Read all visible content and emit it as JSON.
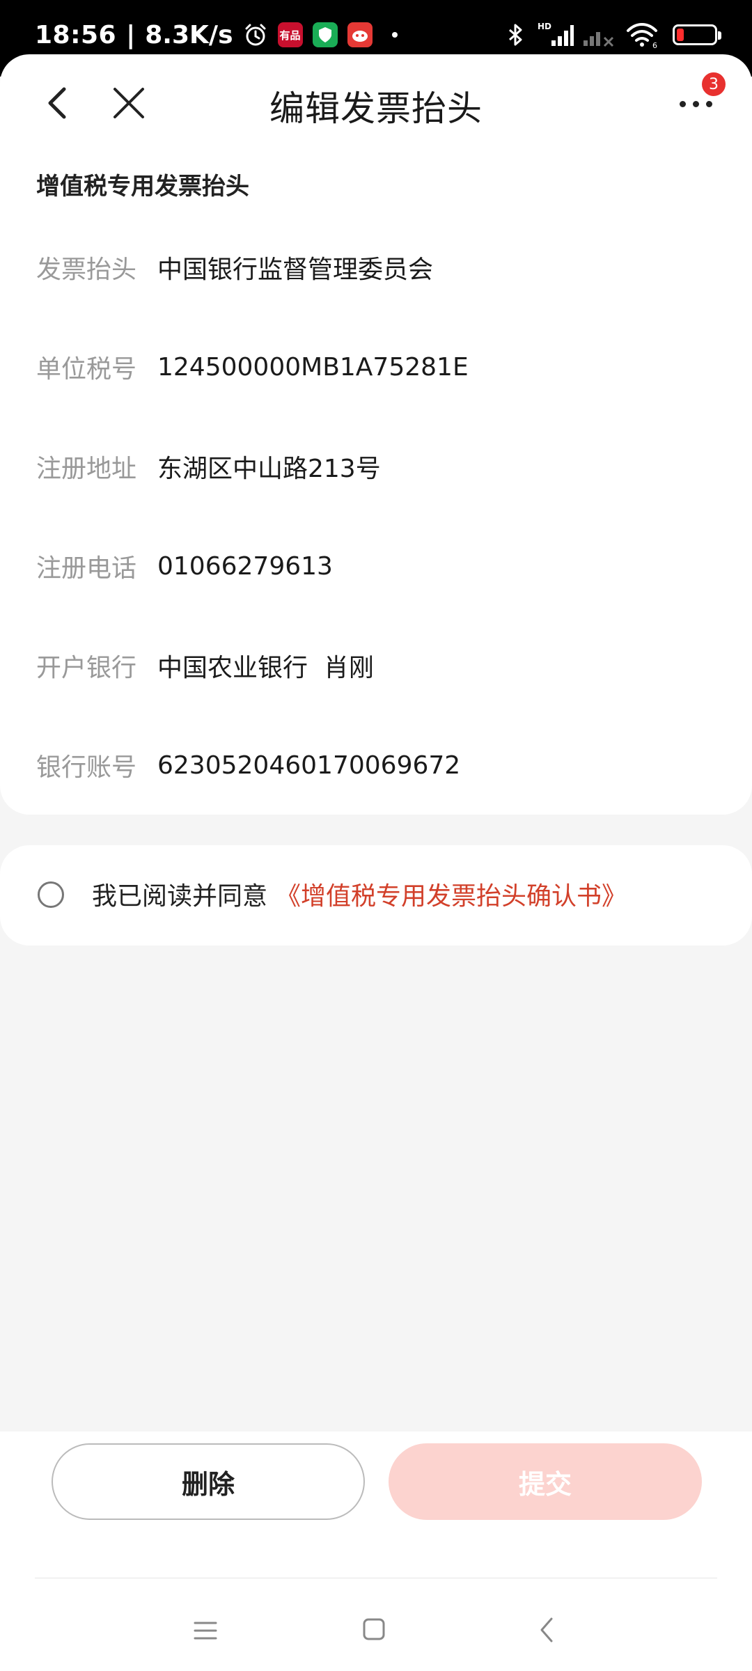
{
  "status_bar": {
    "time": "18:56",
    "separator": "|",
    "net_speed": "8.3K/s",
    "app_icons": [
      {
        "name": "alarm-icon"
      },
      {
        "name": "app-red-icon",
        "label": "有品"
      },
      {
        "name": "shield-app-icon"
      },
      {
        "name": "red-app-icon"
      }
    ],
    "right_icons": [
      "bluetooth-icon",
      "hd-signal-icon",
      "signal-off-icon",
      "wifi-icon",
      "battery-icon"
    ],
    "hd_label": "HD",
    "wifi_label": "6",
    "battery_color": "#ff2d2d"
  },
  "header": {
    "title": "编辑发票抬头",
    "back_icon": "chevron-left-icon",
    "close_icon": "close-icon",
    "more_icon": "more-dots-icon",
    "badge_count": "3"
  },
  "invoice": {
    "section_title": "增值税专用发票抬头",
    "fields": [
      {
        "label": "发票抬头",
        "value": "中国银行监督管理委员会"
      },
      {
        "label": "单位税号",
        "value": "124500000MB1A75281E"
      },
      {
        "label": "注册地址",
        "value": "东湖区中山路213号"
      },
      {
        "label": "注册电话",
        "value": "01066279613"
      },
      {
        "label": "开户银行",
        "value": "中国农业银行  肖刚"
      },
      {
        "label": "银行账号",
        "value": "6230520460170069672"
      }
    ]
  },
  "agreement": {
    "text": "我已阅读并同意",
    "link": "《增值税专用发票抬头确认书》",
    "checked": false,
    "link_color": "#d2402a"
  },
  "actions": {
    "delete_label": "删除",
    "submit_label": "提交",
    "submit_color": "#fcd3cf"
  },
  "nav_bar": {
    "icons": [
      "menu-icon",
      "home-icon",
      "back-icon"
    ]
  }
}
